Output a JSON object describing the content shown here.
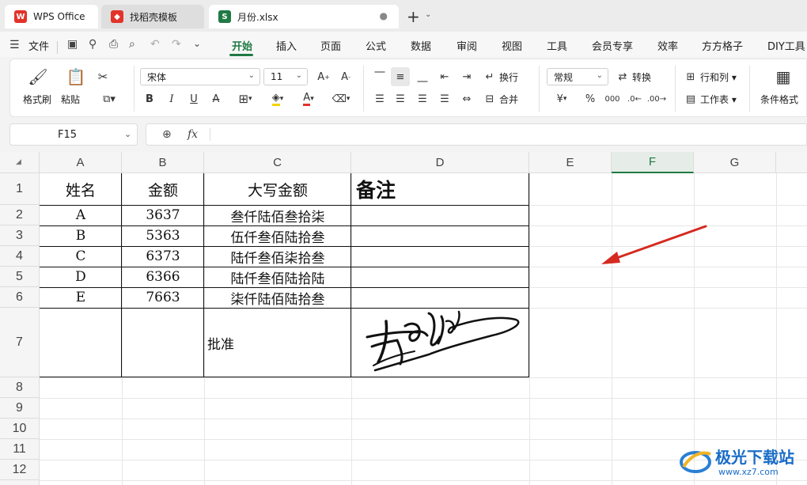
{
  "tabs": [
    {
      "label": "WPS Office",
      "icon": "wps-logo-icon"
    },
    {
      "label": "找稻壳模板",
      "icon": "docer-icon"
    },
    {
      "label": "月份.xlsx",
      "icon": "spreadsheet-s-icon"
    }
  ],
  "menu": {
    "file": "文件",
    "items": [
      "开始",
      "插入",
      "页面",
      "公式",
      "数据",
      "审阅",
      "视图",
      "工具",
      "会员专享",
      "效率",
      "方方格子",
      "DIY工具"
    ],
    "active": "开始"
  },
  "ribbon": {
    "format_painter": "格式刷",
    "paste": "粘贴",
    "font_name": "宋体",
    "font_size": "11",
    "wrap": "换行",
    "merge": "合并",
    "number_format": "常规",
    "convert": "转换",
    "rows_cols": "行和列",
    "worksheet": "工作表",
    "cond_format": "条件格式",
    "bold": "B",
    "italic": "I",
    "underline": "U",
    "percent": "%"
  },
  "formula_bar": {
    "name_box": "F15",
    "fx": "fx",
    "content": ""
  },
  "columns": [
    "A",
    "B",
    "C",
    "D",
    "E",
    "F",
    "G"
  ],
  "rows": [
    "1",
    "2",
    "3",
    "4",
    "5",
    "6",
    "7",
    "8",
    "9",
    "10",
    "11",
    "12"
  ],
  "table": {
    "headers": [
      "姓名",
      "金额",
      "大写金额",
      "备注"
    ],
    "rows": [
      [
        "A",
        "3637",
        "叁仟陆佰叁拾柒"
      ],
      [
        "B",
        "5363",
        "伍仟叁佰陆拾叁"
      ],
      [
        "C",
        "6373",
        "陆仟叁佰柒拾叁"
      ],
      [
        "D",
        "6366",
        "陆仟叁佰陆拾陆"
      ],
      [
        "E",
        "7663",
        "柒仟陆佰陆拾叁"
      ]
    ],
    "approve_label": "批准"
  },
  "watermark": {
    "text": "极光下载站",
    "url": "www.xz7.com"
  },
  "colors": {
    "accent_green": "#1f7a43",
    "arrow_red": "#d42a20",
    "wps_red": "#e2332a"
  }
}
